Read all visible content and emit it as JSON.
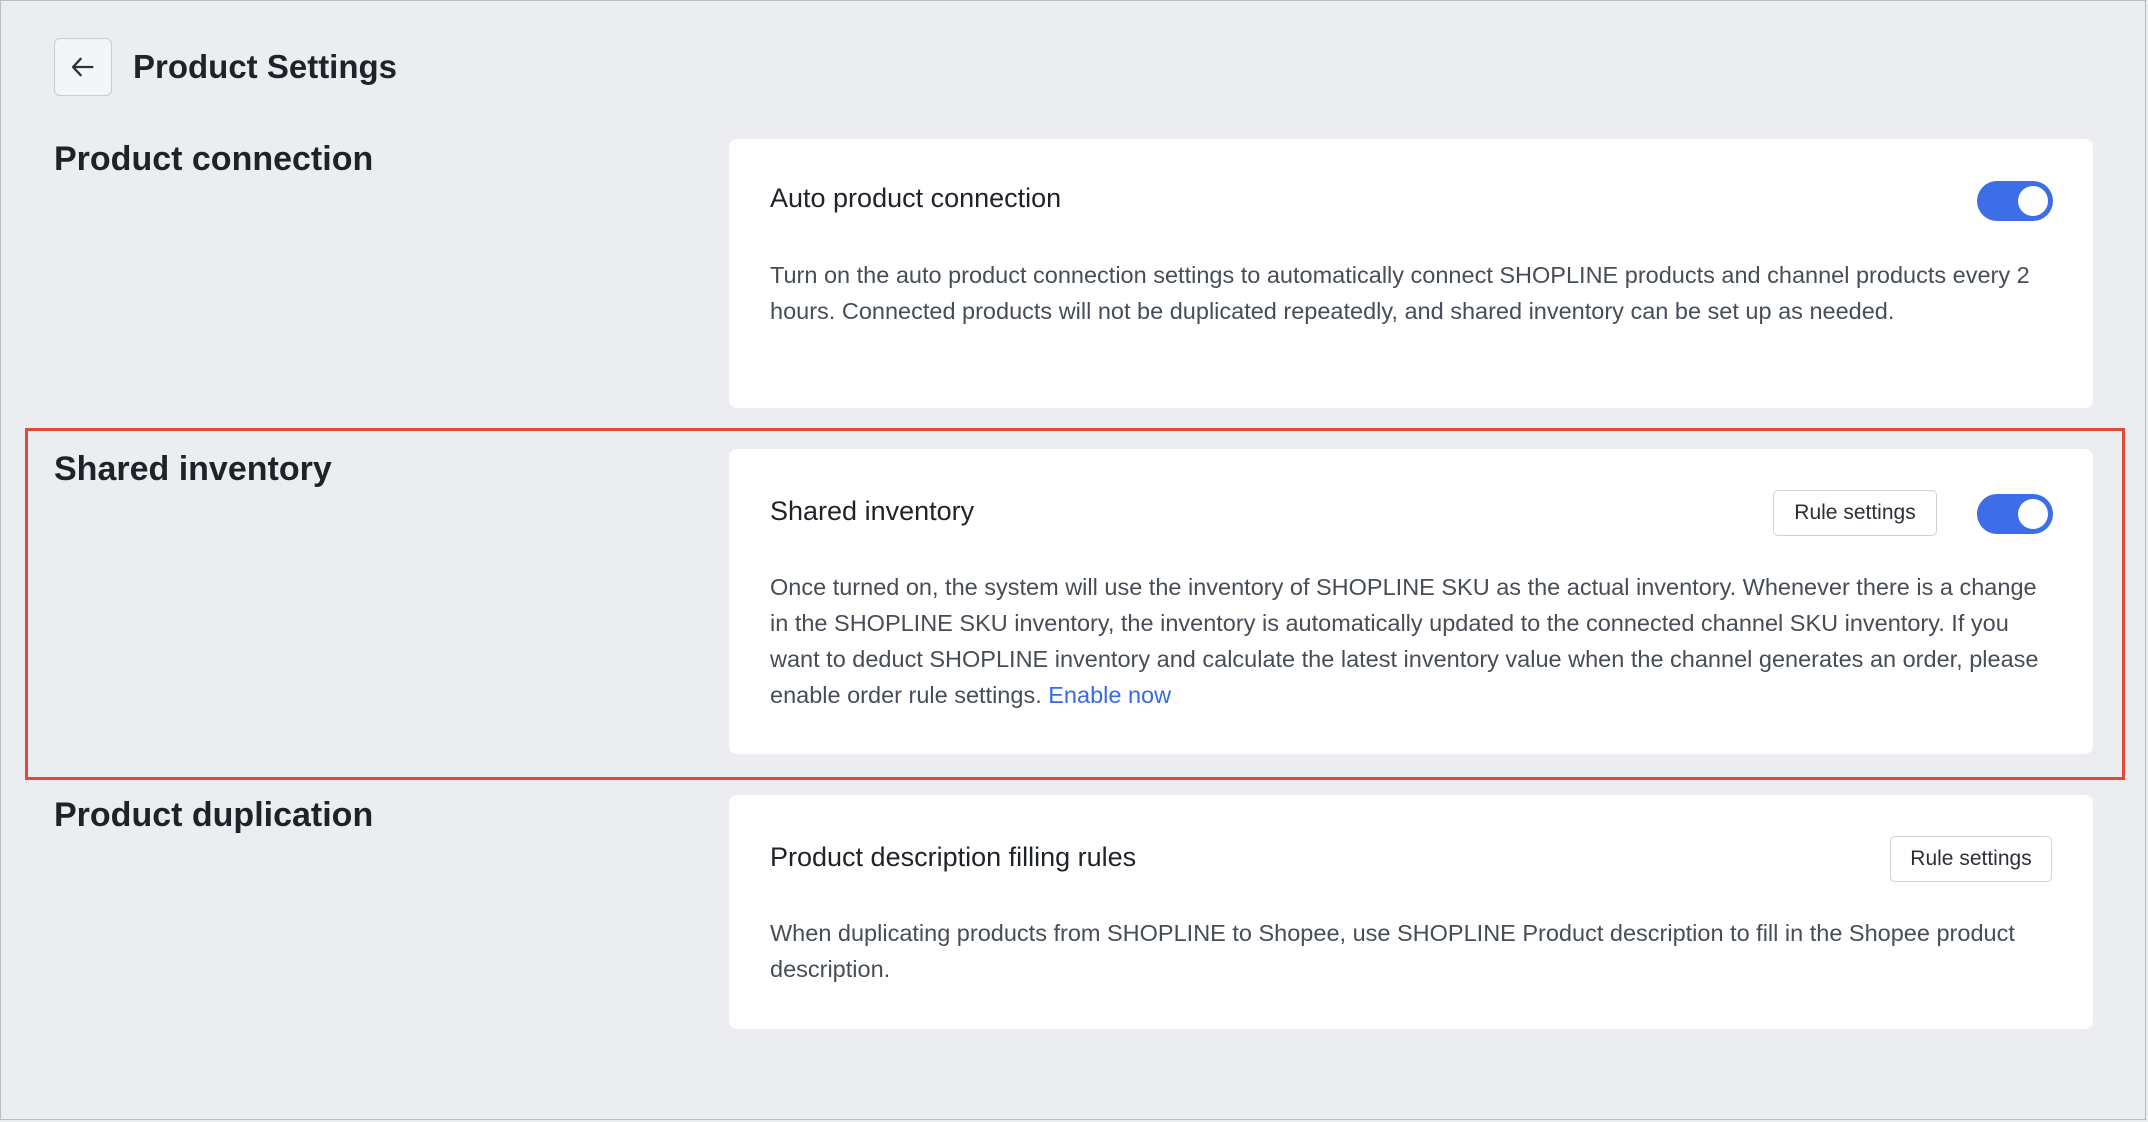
{
  "header": {
    "title": "Product Settings",
    "back_icon": "arrow-left-icon"
  },
  "sections": {
    "connection": {
      "title": "Product connection",
      "card": {
        "title": "Auto product connection",
        "description": "Turn on the auto product connection settings to automatically connect SHOPLINE products and channel products every 2 hours. Connected products will not be duplicated repeatedly, and shared inventory can be set up as needed.",
        "toggle_on": true
      }
    },
    "inventory": {
      "title": "Shared inventory",
      "card": {
        "title": "Shared inventory",
        "rule_button": "Rule settings",
        "description": "Once turned on, the system will use the inventory of SHOPLINE SKU as the actual inventory. Whenever there is a change in the SHOPLINE SKU inventory, the inventory is automatically updated to the connected channel SKU inventory. If you want to deduct SHOPLINE inventory and calculate the latest inventory value when the channel generates an order, please enable order rule settings.",
        "link": "Enable now",
        "toggle_on": true
      }
    },
    "duplication": {
      "title": "Product duplication",
      "card": {
        "title": "Product description filling rules",
        "rule_button": "Rule settings",
        "description": "When duplicating products from SHOPLINE to Shopee, use SHOPLINE Product description to fill in the Shopee product description."
      }
    }
  },
  "colors": {
    "background": "#ecedf1",
    "toggle_on": "#3d6ee8",
    "link": "#356ae6",
    "highlight": "#e24a35"
  }
}
